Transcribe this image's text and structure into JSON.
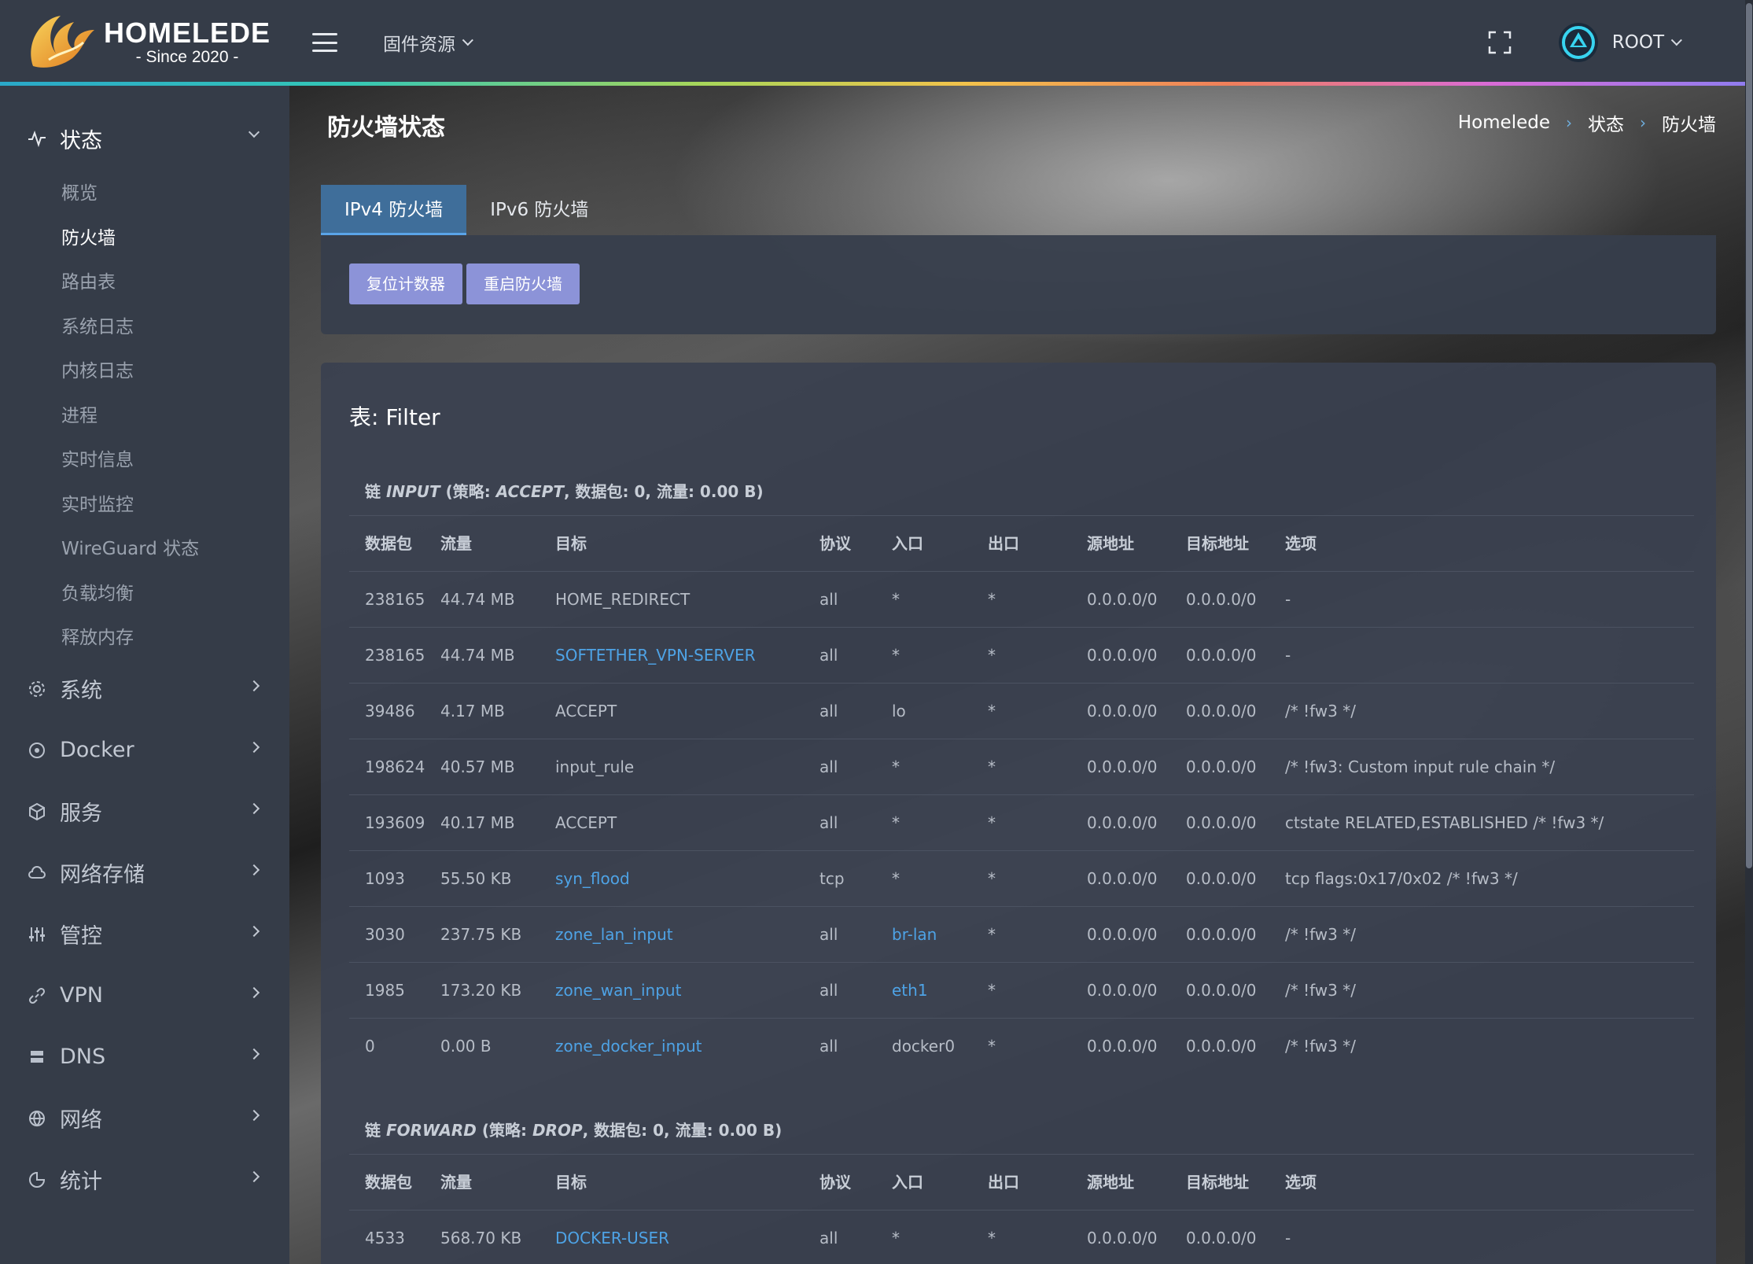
{
  "brand": {
    "title": "HOMELEDE",
    "subtitle": "- Since 2020 -"
  },
  "header": {
    "firmware_menu": "固件资源",
    "user": "ROOT"
  },
  "sidebar": {
    "status": {
      "label": "状态",
      "items": [
        "概览",
        "防火墙",
        "路由表",
        "系统日志",
        "内核日志",
        "进程",
        "实时信息",
        "实时监控",
        "WireGuard 状态",
        "负载均衡",
        "释放内存"
      ]
    },
    "groups": [
      "系统",
      "Docker",
      "服务",
      "网络存储",
      "管控",
      "VPN",
      "DNS",
      "网络",
      "统计"
    ]
  },
  "page": {
    "title": "防火墙状态",
    "breadcrumb": [
      "Homelede",
      "状态",
      "防火墙"
    ],
    "tabs": [
      "IPv4 防火墙",
      "IPv6 防火墙"
    ],
    "buttons": {
      "reset": "复位计数器",
      "restart": "重启防火墙"
    }
  },
  "table_title": "表: Filter",
  "columns": [
    "数据包",
    "流量",
    "目标",
    "协议",
    "入口",
    "出口",
    "源地址",
    "目标地址",
    "选项"
  ],
  "input_chain": {
    "prefix": "链 ",
    "name": "INPUT",
    "p1": " (策略: ",
    "policy": "ACCEPT",
    "p2": ", 数据包: 0, 流量: 0.00 B)",
    "rows": [
      [
        "238165",
        "44.74 MB",
        "HOME_REDIRECT",
        "all",
        "*",
        "*",
        "0.0.0.0/0",
        "0.0.0.0/0",
        "-"
      ],
      [
        "238165",
        "44.74 MB",
        "SOFTETHER_VPN-SERVER",
        "all",
        "*",
        "*",
        "0.0.0.0/0",
        "0.0.0.0/0",
        "-"
      ],
      [
        "39486",
        "4.17 MB",
        "ACCEPT",
        "all",
        "lo",
        "*",
        "0.0.0.0/0",
        "0.0.0.0/0",
        "/* !fw3 */"
      ],
      [
        "198624",
        "40.57 MB",
        "input_rule",
        "all",
        "*",
        "*",
        "0.0.0.0/0",
        "0.0.0.0/0",
        "/* !fw3: Custom input rule chain */"
      ],
      [
        "193609",
        "40.17 MB",
        "ACCEPT",
        "all",
        "*",
        "*",
        "0.0.0.0/0",
        "0.0.0.0/0",
        "ctstate RELATED,ESTABLISHED /* !fw3 */"
      ],
      [
        "1093",
        "55.50 KB",
        "syn_flood",
        "tcp",
        "*",
        "*",
        "0.0.0.0/0",
        "0.0.0.0/0",
        "tcp flags:0x17/0x02 /* !fw3 */"
      ],
      [
        "3030",
        "237.75 KB",
        "zone_lan_input",
        "all",
        "br-lan",
        "*",
        "0.0.0.0/0",
        "0.0.0.0/0",
        "/* !fw3 */"
      ],
      [
        "1985",
        "173.20 KB",
        "zone_wan_input",
        "all",
        "eth1",
        "*",
        "0.0.0.0/0",
        "0.0.0.0/0",
        "/* !fw3 */"
      ],
      [
        "0",
        "0.00 B",
        "zone_docker_input",
        "all",
        "docker0",
        "*",
        "0.0.0.0/0",
        "0.0.0.0/0",
        "/* !fw3 */"
      ]
    ],
    "target_links": [
      false,
      true,
      false,
      false,
      false,
      true,
      true,
      true,
      true
    ],
    "in_links": [
      false,
      false,
      false,
      false,
      false,
      false,
      true,
      true,
      false
    ]
  },
  "forward_chain": {
    "prefix": "链 ",
    "name": "FORWARD",
    "p1": " (策略: ",
    "policy": "DROP",
    "p2": ", 数据包: 0, 流量: 0.00 B)",
    "rows": [
      [
        "4533",
        "568.70 KB",
        "DOCKER-USER",
        "all",
        "*",
        "*",
        "0.0.0.0/0",
        "0.0.0.0/0",
        "-"
      ]
    ],
    "target_links": [
      true
    ],
    "in_links": [
      false
    ]
  },
  "colors": {
    "accent": "#4ea3e6",
    "button": "#8c93d8",
    "tab_active": "#3f6e9a"
  },
  "icons": {
    "menu": "hamburger-icon",
    "fullscreen": "fullscreen-icon",
    "status": "activity-icon"
  }
}
